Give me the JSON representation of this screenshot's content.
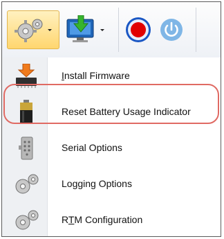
{
  "toolbar": {
    "buttons": [
      {
        "icon": "gear-icon",
        "has_dropdown": true,
        "active": true
      },
      {
        "icon": "monitor-download-icon",
        "has_dropdown": true
      },
      {
        "icon": "record-icon",
        "color": "#e10000"
      },
      {
        "icon": "power-icon",
        "color": "#7fb6e6",
        "disabled": true
      }
    ]
  },
  "menu": {
    "items": [
      {
        "label": "Install Firmware",
        "mnemonic": "I",
        "icon": "chip-download-icon"
      },
      {
        "label": "Reset Battery Usage Indicator",
        "icon": "battery-icon",
        "highlighted": true
      },
      {
        "label": "Serial Options",
        "icon": "serial-connector-icon"
      },
      {
        "label": "Logging Options",
        "icon": "gear-icon"
      },
      {
        "label": "RTM Configuration",
        "mnemonic": "T",
        "icon": "gear-icon"
      }
    ]
  },
  "colors": {
    "highlight_ring": "#e06a63",
    "active_button": "#ffd66f",
    "record": "#e10000",
    "power": "#7fb6e6"
  }
}
